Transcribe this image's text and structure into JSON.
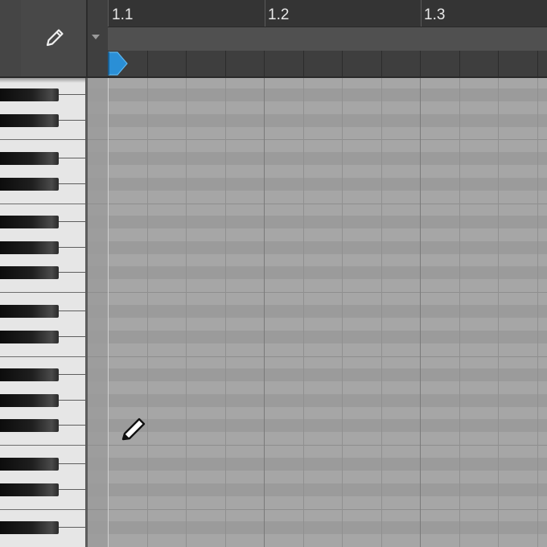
{
  "ruler": {
    "bars": [
      "1.1",
      "1.2",
      "1.3"
    ]
  },
  "toolbar": {
    "tool_icon": "pencil-icon",
    "dropdown_icon": "caret-down-icon"
  },
  "colors": {
    "playhead": "#2a8fd6",
    "ruler_bg": "#3f3f3f",
    "grid_light": "#a6a6a6",
    "grid_dark": "#9b9b9b"
  }
}
